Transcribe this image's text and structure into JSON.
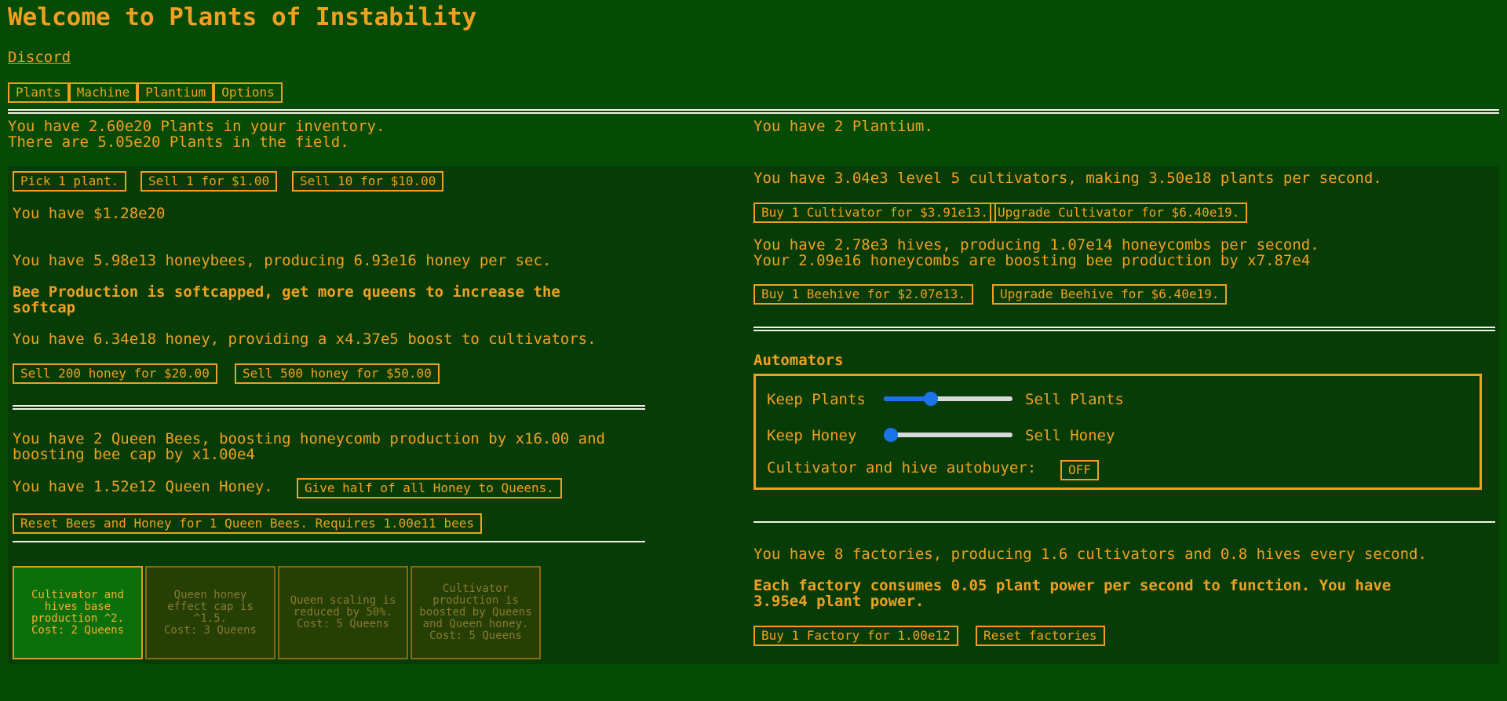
{
  "header": {
    "title": "Welcome to Plants of Instability",
    "discord": "Discord",
    "tabs": [
      "Plants",
      "Machine",
      "Plantium",
      "Options"
    ]
  },
  "top": {
    "inventory": "You have 2.60e20 Plants in your inventory.",
    "field": "There are 5.05e20 Plants in the field.",
    "plantium": "You have 2 Plantium."
  },
  "left": {
    "pick_btn": "Pick 1 plant.",
    "sell1_btn": "Sell 1 for $1.00",
    "sell10_btn": "Sell 10 for $10.00",
    "money": "You have $1.28e20",
    "bees": "You have 5.98e13 honeybees, producing 6.93e16 honey per sec.",
    "softcap_line1": "Bee Production is softcapped, get more queens to increase the",
    "softcap_line2": "softcap",
    "honey": "You have 6.34e18 honey, providing a x4.37e5 boost to cultivators.",
    "sell200_btn": "Sell 200 honey for $20.00",
    "sell500_btn": "Sell 500 honey for $50.00",
    "queens_line1": "You have 2 Queen Bees, boosting honeycomb production by x16.00 and",
    "queens_line2": "boosting bee cap by x1.00e4",
    "queen_honey": "You have 1.52e12 Queen Honey.",
    "give_half_btn": "Give half of all Honey to Queens.",
    "reset_bees_btn": "Reset Bees and Honey for 1 Queen Bees. Requires 1.00e11 bees",
    "upgrades": [
      {
        "text": "Cultivator and hives base production ^2.",
        "cost": "Cost: 2 Queens",
        "bought": true
      },
      {
        "text": "Queen honey effect cap is ^1.5.",
        "cost": "Cost: 3 Queens",
        "bought": false
      },
      {
        "text": "Queen scaling is reduced by 50%.",
        "cost": "Cost: 5 Queens",
        "bought": false
      },
      {
        "text": "Cultivator production is boosted by Queens and Queen honey.",
        "cost": "Cost: 5 Queens",
        "bought": false
      }
    ]
  },
  "right": {
    "cultivators": "You have 3.04e3 level 5 cultivators, making 3.50e18 plants per second.",
    "buy_cultivator_btn": "Buy 1 Cultivator for $3.91e13.",
    "upgrade_cultivator_btn": "Upgrade Cultivator for $6.40e19.",
    "hives": "You have 2.78e3 hives, producing 1.07e14 honeycombs per second.",
    "honeycombs": "Your 2.09e16 honeycombs are boosting bee production by x7.87e4",
    "buy_beehive_btn": "Buy 1 Beehive for $2.07e13.",
    "upgrade_beehive_btn": "Upgrade Beehive for $6.40e19.",
    "automators_title": "Automators",
    "keep_plants": "Keep Plants",
    "sell_plants": "Sell Plants",
    "plants_slider": 0.35,
    "keep_honey": "Keep Honey",
    "sell_honey": "Sell Honey",
    "honey_slider": 0.0,
    "autobuyer_label": "Cultivator and hive autobuyer:",
    "autobuyer_btn": "OFF",
    "factories": "You have 8 factories, producing 1.6 cultivators and 0.8 hives every second.",
    "factory_consume_line1": "Each factory consumes 0.05 plant power per second to function. You have",
    "factory_consume_line2": "3.95e4 plant power.",
    "buy_factory_btn": "Buy 1 Factory for 1.00e12",
    "reset_factories_btn": "Reset factories"
  },
  "colors": {
    "background": "#054a05",
    "panel": "#073c07",
    "accent": "#f0a020",
    "slider": "#1a73e8"
  }
}
